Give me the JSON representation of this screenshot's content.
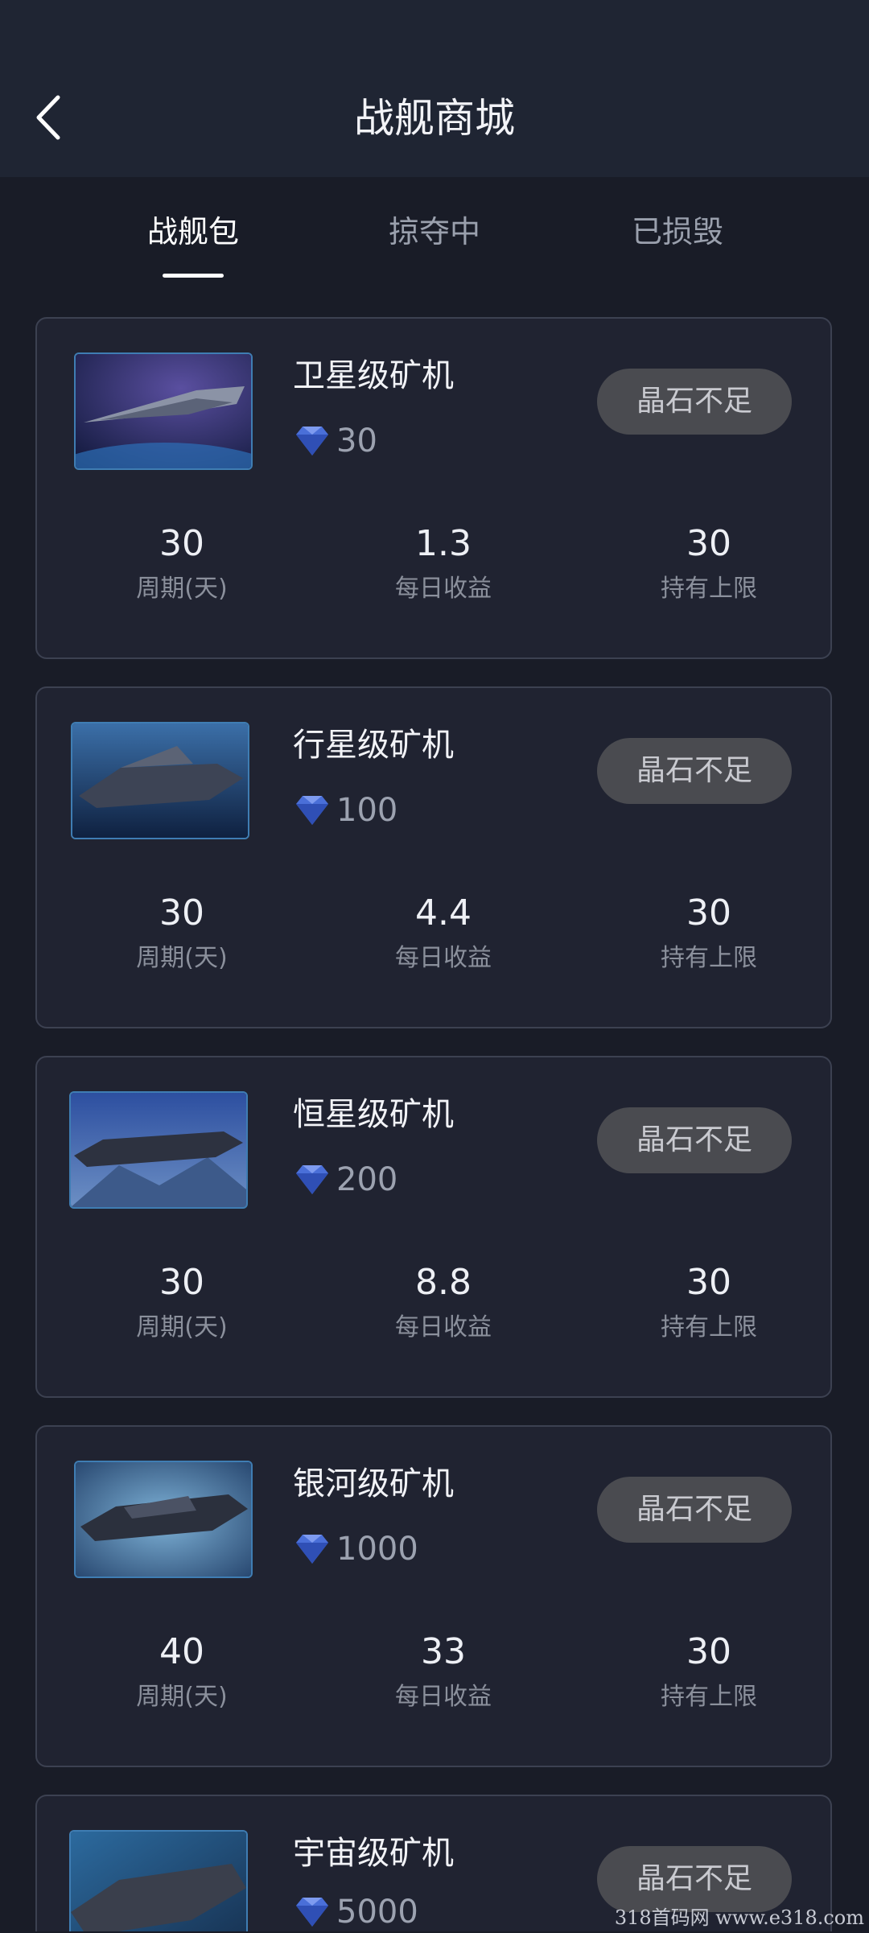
{
  "header": {
    "title": "战舰商城",
    "back_icon": "chevron-left-icon"
  },
  "tabs": [
    {
      "label": "战舰包",
      "active": true
    },
    {
      "label": "掠夺中",
      "active": false
    },
    {
      "label": "已损毁",
      "active": false
    }
  ],
  "stat_labels": {
    "period": "周期(天)",
    "daily": "每日收益",
    "limit": "持有上限"
  },
  "cards": [
    {
      "name": "卫星级矿机",
      "price": "30",
      "button": "晶石不足",
      "period": "30",
      "daily": "1.3",
      "limit": "30"
    },
    {
      "name": "行星级矿机",
      "price": "100",
      "button": "晶石不足",
      "period": "30",
      "daily": "4.4",
      "limit": "30"
    },
    {
      "name": "恒星级矿机",
      "price": "200",
      "button": "晶石不足",
      "period": "30",
      "daily": "8.8",
      "limit": "30"
    },
    {
      "name": "银河级矿机",
      "price": "1000",
      "button": "晶石不足",
      "period": "40",
      "daily": "33",
      "limit": "30"
    },
    {
      "name": "宇宙级矿机",
      "price": "5000",
      "button": "晶石不足"
    }
  ],
  "colors": {
    "background": "#191c27",
    "card": "#202331",
    "gem": "#4a6fd8",
    "button": "#4a4b50"
  },
  "watermark": "318首码网  www.e318.com"
}
